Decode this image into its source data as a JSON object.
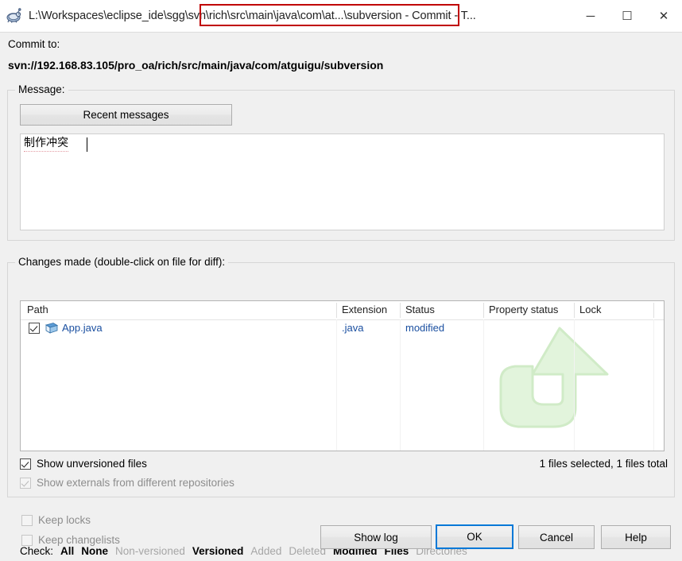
{
  "window": {
    "icon": "tortoise-svn-icon",
    "title_prefix": "L:\\Workspaces\\eclipse_ide\\sgg",
    "title_highlighted": "\\svn\\rich\\src\\main\\java\\com\\at...\\subversion",
    "title_suffix": " - Commit - T...",
    "minimize_label": "─",
    "maximize_label": "☐",
    "close_label": "✕",
    "annotation_color": "#c00000"
  },
  "commit_to": {
    "label": "Commit to:",
    "url": "svn://192.168.83.105/pro_oa/rich/src/main/java/com/atguigu/subversion"
  },
  "message": {
    "legend": "Message:",
    "recent_button": "Recent messages",
    "value": "制作冲突"
  },
  "changes": {
    "legend": "Changes made (double-click on file for diff):",
    "check_label": "Check:",
    "check_links": [
      {
        "label": "All",
        "enabled": true
      },
      {
        "label": "None",
        "enabled": true
      },
      {
        "label": "Non-versioned",
        "enabled": false
      },
      {
        "label": "Versioned",
        "enabled": true
      },
      {
        "label": "Added",
        "enabled": false
      },
      {
        "label": "Deleted",
        "enabled": false
      },
      {
        "label": "Modified",
        "enabled": true
      },
      {
        "label": "Files",
        "enabled": true
      },
      {
        "label": "Directories",
        "enabled": false
      }
    ],
    "columns": [
      "Path",
      "Extension",
      "Status",
      "Property status",
      "Lock"
    ],
    "rows": [
      {
        "checked": true,
        "icon": "java-file-icon",
        "path": "App.java",
        "extension": ".java",
        "status": "modified",
        "property_status": "",
        "lock": ""
      }
    ],
    "watermark": "commit-arrow-watermark",
    "show_unversioned": {
      "label": "Show unversioned files",
      "checked": true,
      "enabled": true
    },
    "show_externals": {
      "label": "Show externals from different repositories",
      "checked": true,
      "enabled": false
    },
    "files_count": "1 files selected, 1 files total"
  },
  "footer": {
    "keep_locks": {
      "label": "Keep locks",
      "checked": false,
      "enabled": false
    },
    "keep_changelists": {
      "label": "Keep changelists",
      "checked": false,
      "enabled": false
    },
    "buttons": {
      "show_log": "Show log",
      "ok": "OK",
      "cancel": "Cancel",
      "help": "Help"
    }
  }
}
